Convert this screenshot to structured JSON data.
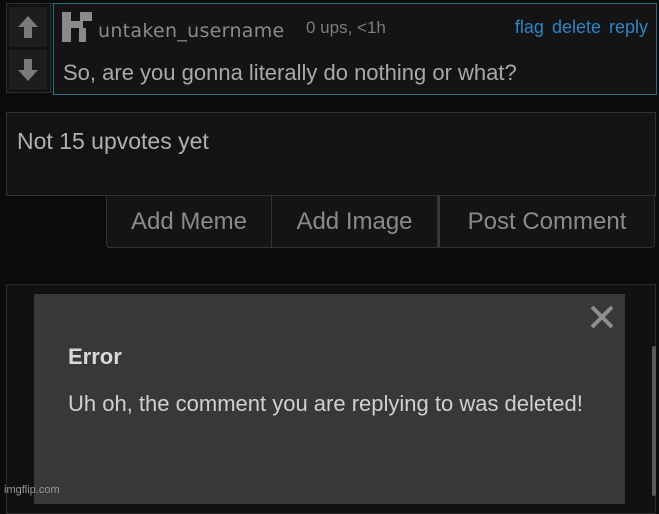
{
  "comment": {
    "username": "untaken_username",
    "meta": "0 ups, <1h",
    "actions": [
      "flag",
      "delete",
      "reply"
    ],
    "text": "So, are you gonna literally do nothing or what?"
  },
  "reply": {
    "value": "Not 15 upvotes yet",
    "buttons": {
      "add_meme": "Add Meme",
      "add_image": "Add Image",
      "post_comment": "Post Comment"
    }
  },
  "error_modal": {
    "title": "Error",
    "message": "Uh oh, the comment you are replying to was deleted!"
  },
  "watermark": "imgflip.com",
  "icons": {
    "upvote": "arrow-up-icon",
    "downvote": "arrow-down-icon",
    "avatar": "avatar-pattern-icon",
    "close": "close-icon"
  },
  "colors": {
    "link": "#2b86c5",
    "highlight_border": "#1f6f86",
    "modal_bg": "#383838"
  }
}
